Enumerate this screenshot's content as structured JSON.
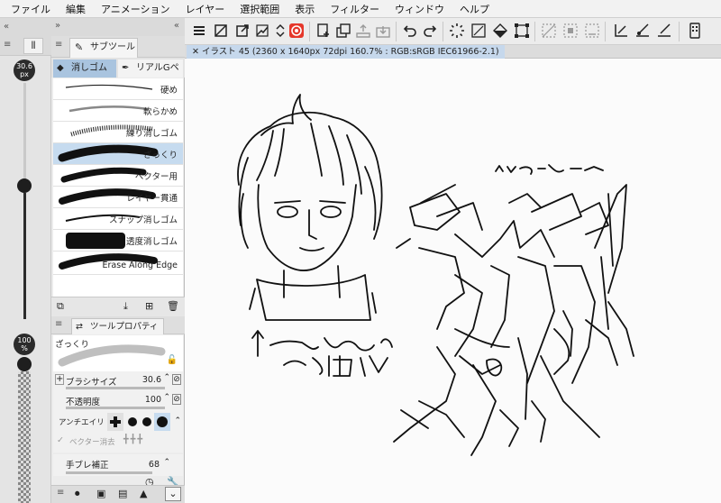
{
  "menubar": [
    "ファイル",
    "編集",
    "アニメーション",
    "レイヤー",
    "選択範囲",
    "表示",
    "フィルター",
    "ウィンドウ",
    "ヘルプ"
  ],
  "toolbar_icons": [
    "menu-icon",
    "new-canvas-icon",
    "open-icon",
    "save-icon",
    "stepper-icon",
    "app-logo-icon",
    "export-icon",
    "duplicate-icon",
    "upload-icon",
    "cloud-icon",
    "undo-icon",
    "redo-icon",
    "loading-icon",
    "clear-icon",
    "fill-icon",
    "select-transform-icon",
    "deselect-icon",
    "invert-selection-icon",
    "crop-icon",
    "ruler-icon",
    "brush-snap-icon",
    "pen-snap-icon",
    "device-icon"
  ],
  "left_column": {
    "brush_size_badge": {
      "value": "30.6",
      "unit": "px"
    },
    "opacity_badge": {
      "value": "100",
      "unit": "%"
    }
  },
  "subtool_panel": {
    "tab_label": "サブツール",
    "groups": [
      "消しゴム",
      "リアルGペ"
    ],
    "items": [
      {
        "label": "硬め"
      },
      {
        "label": "軟らかめ"
      },
      {
        "label": "練り消しゴム"
      },
      {
        "label": "ざっくり",
        "selected": true
      },
      {
        "label": "ベクター用"
      },
      {
        "label": "レイヤー貫通"
      },
      {
        "label": "スナップ消しゴム"
      },
      {
        "label": "透度消しゴム"
      },
      {
        "label": "Erase Along Edge"
      }
    ]
  },
  "tool_property": {
    "tab_label": "ツールプロパティ",
    "tool_name": "ざっくり",
    "brush_size": {
      "label": "ブラシサイズ",
      "value": "30.6"
    },
    "opacity": {
      "label": "不透明度",
      "value": "100"
    },
    "antialias": {
      "label": "アンチエイリ"
    },
    "vector_erase": {
      "label": "ベクター消去"
    },
    "stabilization": {
      "label": "手ブレ補正",
      "value": "68"
    }
  },
  "canvas": {
    "doc_tab": "イラスト 45 (2360 x 1640px 72dpi 160.7% : RGB:sRGB IEC61966-2.1)"
  },
  "colors": {
    "selection": "#c6dbef",
    "group_active": "#a9c4df",
    "ink": "#111111"
  }
}
